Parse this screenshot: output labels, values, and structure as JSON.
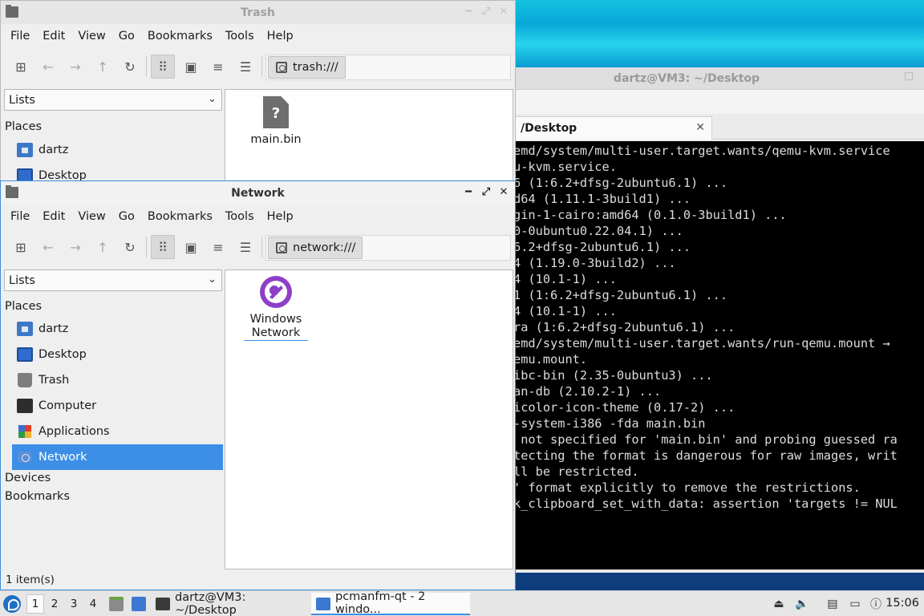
{
  "terminal": {
    "title": "dartz@VM3: ~/Desktop",
    "tab_label": "/Desktop",
    "tab_close": "✕",
    "lines": [
      "emd/system/multi-user.target.wants/qemu-kvm.service",
      "u-kvm.service.",
      "6 (1:6.2+dfsg-2ubuntu6.1) ...",
      "d64 (1.11.1-3build1) ...",
      "gin-1-cairo:amd64 (0.1.0-3build1) ...",
      "0-0ubuntu0.22.04.1) ...",
      "6.2+dfsg-2ubuntu6.1) ...",
      "4 (1.19.0-3build2) ...",
      "4 (10.1-1) ...",
      "1 (1:6.2+dfsg-2ubuntu6.1) ...",
      "4 (10.1-1) ...",
      "ra (1:6.2+dfsg-2ubuntu6.1) ...",
      "emd/system/multi-user.target.wants/run-qemu.mount →",
      "emu.mount.",
      "ibc-bin (2.35-0ubuntu3) ...",
      "an-db (2.10.2-1) ...",
      "icolor-icon-theme (0.17-2) ...",
      "-system-i386 -fda main.bin",
      " not specified for 'main.bin' and probing guessed ra",
      "",
      "tecting the format is dangerous for raw images, writ",
      "ll be restricted.",
      "' format explicitly to remove the restrictions.",
      "k_clipboard_set_with_data: assertion 'targets != NUL"
    ]
  },
  "menu": [
    "File",
    "Edit",
    "View",
    "Go",
    "Bookmarks",
    "Tools",
    "Help"
  ],
  "trash_window": {
    "title": "Trash",
    "path": "trash:///",
    "side_combo": "Lists",
    "places_heading": "Places",
    "places": [
      "dartz",
      "Desktop"
    ],
    "files": [
      {
        "name": "main.bin",
        "glyph": "?"
      }
    ]
  },
  "network_window": {
    "title": "Network",
    "path": "network:///",
    "side_combo": "Lists",
    "places_heading": "Places",
    "places": [
      "dartz",
      "Desktop",
      "Trash",
      "Computer",
      "Applications",
      "Network"
    ],
    "devices_heading": "Devices",
    "bookmarks_heading": "Bookmarks",
    "files": [
      {
        "name": "Windows Network"
      }
    ],
    "status": "1 item(s)"
  },
  "window_controls": {
    "minimize": "━",
    "maximize": "⤢",
    "close": "✕"
  },
  "taskbar": {
    "workspaces": [
      "1",
      "2",
      "3",
      "4"
    ],
    "tasks": [
      "dartz@VM3: ~/Desktop",
      "pcmanfm-qt - 2 windo..."
    ],
    "clock": "15:06"
  },
  "colors": {
    "accent": "#3c8ee6",
    "terminal_bg": "#000000"
  }
}
